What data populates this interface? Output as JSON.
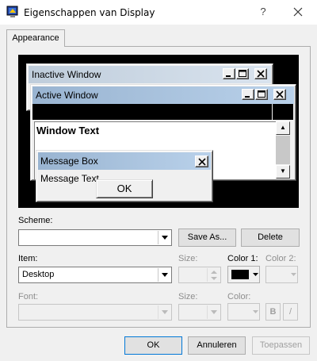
{
  "window": {
    "title": "Eigenschappen van Display",
    "help": "?"
  },
  "tabs": [
    {
      "label": "Appearance"
    }
  ],
  "preview": {
    "inactive_title": "Inactive Window",
    "active_title": "Active Window",
    "window_text": "Window Text",
    "msgbox_title": "Message Box",
    "msgbox_text": "Message Text",
    "msgbox_ok": "OK"
  },
  "scheme": {
    "label": "Scheme:",
    "value": "",
    "save_as": "Save As...",
    "delete": "Delete"
  },
  "item": {
    "label": "Item:",
    "value": "Desktop",
    "size_label": "Size:",
    "color1_label": "Color 1:",
    "color2_label": "Color 2:",
    "color1_value": "#000000"
  },
  "font": {
    "label": "Font:",
    "value": "",
    "size_label": "Size:",
    "color_label": "Color:",
    "bold": "B",
    "italic": "/"
  },
  "buttons": {
    "ok": "OK",
    "cancel": "Annuleren",
    "apply": "Toepassen"
  },
  "colors": {
    "active_title": "#99b4d1",
    "inactive_title": "#bfcddb",
    "default_border": "#0078d7"
  }
}
